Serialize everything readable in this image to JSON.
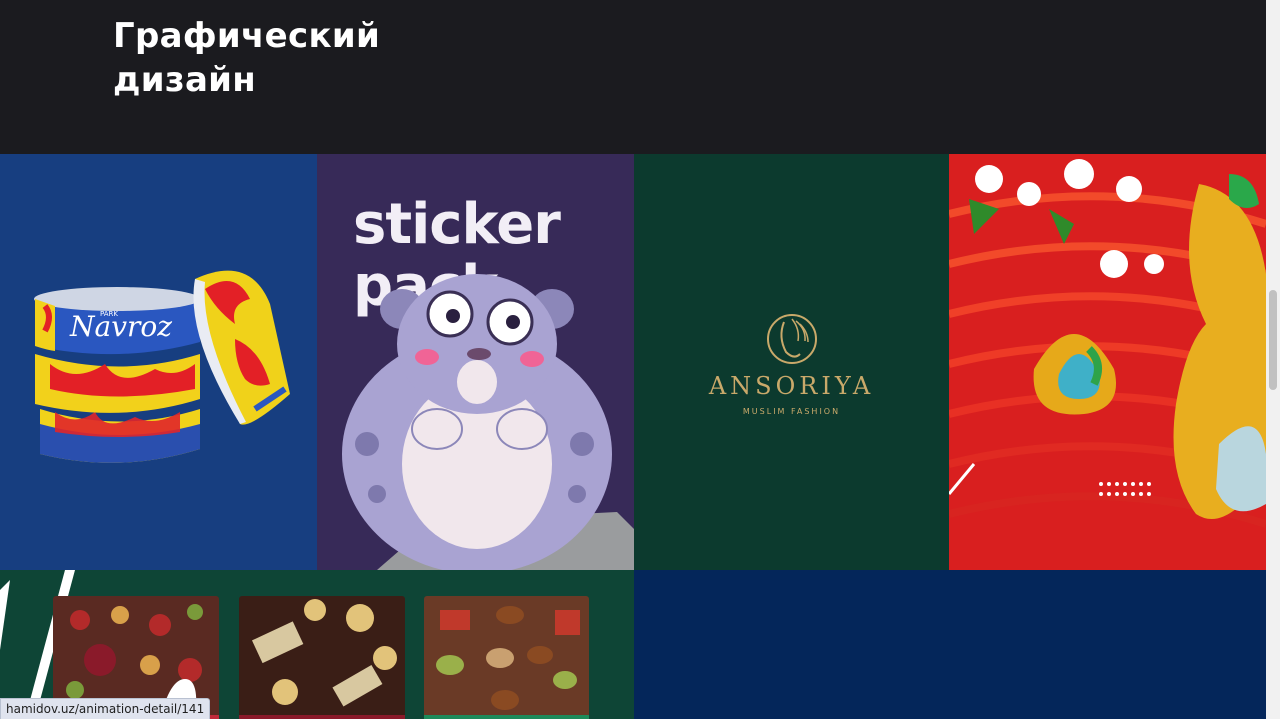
{
  "section": {
    "title_line1": "Графический",
    "title_line2": "дизайн"
  },
  "portfolio": {
    "tiles": [
      {
        "name": "navroz-packaging",
        "logo_text": "Navroz",
        "small_text": "PARK"
      },
      {
        "name": "sticker-pack",
        "title": "sticker pack"
      },
      {
        "name": "ansoriya-logo",
        "brand": "ANSORIYA",
        "tagline": "MUSLIM FASHION"
      },
      {
        "name": "jewelry-poster"
      },
      {
        "name": "chocolate-bars"
      },
      {
        "name": "blank-blue-tile"
      }
    ]
  },
  "status_bar": {
    "url": "hamidov.uz/animation-detail/141"
  },
  "colors": {
    "background": "#1b1b1f",
    "navroz_blue": "#173e80",
    "sticker_purple": "#372a58",
    "ansoriya_green": "#0c3a2e",
    "jewelry_red": "#d91f1f",
    "chocolate_green": "#0e4536",
    "navy": "#04265a",
    "gold": "#c9a96a"
  }
}
